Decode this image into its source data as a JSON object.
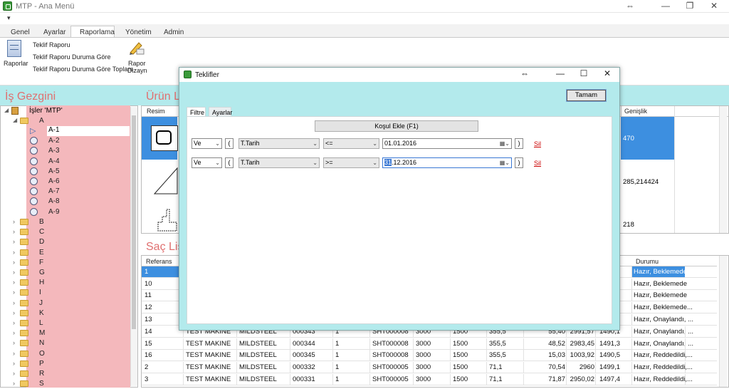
{
  "window": {
    "title": "MTP - Ana Menü",
    "restore_glyph": "⇔",
    "min_glyph": "—",
    "max_glyph": "❐",
    "close_glyph": "✕"
  },
  "qat_glyph": "▾",
  "ribbon": {
    "tabs": [
      "Genel",
      "Ayarlar",
      "Raporlama",
      "Yönetim",
      "Admin"
    ],
    "active_tab": "Raporlama",
    "raporlar_label": "Raporlar",
    "items": [
      "Teklif Raporu",
      "Teklif Raporu Duruma Göre",
      "Teklif Raporu Duruma Göre Toplam"
    ],
    "design_label_1": "Rapor",
    "design_label_2": "Dizayn"
  },
  "is_gezgini": {
    "title": "İş Gezgini",
    "root": "İşler 'MTP'",
    "open_folder": "A",
    "leaves": [
      "A-1",
      "A-2",
      "A-3",
      "A-4",
      "A-5",
      "A-6",
      "A-7",
      "A-8",
      "A-9"
    ],
    "folders": [
      "B",
      "C",
      "D",
      "E",
      "F",
      "G",
      "H",
      "I",
      "J",
      "K",
      "L",
      "M",
      "N",
      "O",
      "P",
      "R",
      "S"
    ]
  },
  "urun": {
    "title_partial": "Ürün Li",
    "headers": {
      "resim": "Resim",
      "genislik": "Genişlik"
    },
    "genislik_values": [
      "470",
      "285,214424",
      "218"
    ]
  },
  "sac": {
    "title_partial": "Saç Lis",
    "headers": {
      "referans": "Referans",
      "durumu": "Durumu"
    },
    "top_rows": [
      {
        "ref": "1",
        "durum": "Hazır, Beklemede"
      },
      {
        "ref": "10",
        "durum": "Hazır, Beklemede"
      },
      {
        "ref": "11",
        "durum": "Hazır, Beklemede"
      },
      {
        "ref": "12",
        "durum": "Hazır, Beklemede..."
      },
      {
        "ref": "13",
        "durum": "Hazır, Onaylandı, ..."
      }
    ],
    "rows": [
      {
        "ref": "14",
        "musteri": "TEST MAKINE",
        "malzeme": "MILDSTEEL",
        "kod": "000343",
        "adet": "1",
        "sht": "SHT000008",
        "en": "3000",
        "boy": "1500",
        "k": "355,5",
        "v1": "55,40",
        "v2": "2991,57",
        "v3": "1490,1",
        "durum": "Hazır, Onaylandı, ..."
      },
      {
        "ref": "15",
        "musteri": "TEST MAKINE",
        "malzeme": "MILDSTEEL",
        "kod": "000344",
        "adet": "1",
        "sht": "SHT000008",
        "en": "3000",
        "boy": "1500",
        "k": "355,5",
        "v1": "48,52",
        "v2": "2983,45",
        "v3": "1491,3",
        "durum": "Hazır, Onaylandı, ..."
      },
      {
        "ref": "16",
        "musteri": "TEST MAKINE",
        "malzeme": "MILDSTEEL",
        "kod": "000345",
        "adet": "1",
        "sht": "SHT000008",
        "en": "3000",
        "boy": "1500",
        "k": "355,5",
        "v1": "15,03",
        "v2": "1003,92",
        "v3": "1490,5",
        "durum": "Hazır, Reddedildi,..."
      },
      {
        "ref": "2",
        "musteri": "TEST MAKINE",
        "malzeme": "MILDSTEEL",
        "kod": "000332",
        "adet": "1",
        "sht": "SHT000005",
        "en": "3000",
        "boy": "1500",
        "k": "71,1",
        "v1": "70,54",
        "v2": "2960",
        "v3": "1499,1",
        "durum": "Hazır, Reddedildi,..."
      },
      {
        "ref": "3",
        "musteri": "TEST MAKINE",
        "malzeme": "MILDSTEEL",
        "kod": "000331",
        "adet": "1",
        "sht": "SHT000005",
        "en": "3000",
        "boy": "1500",
        "k": "71,1",
        "v1": "71,87",
        "v2": "2950,02",
        "v3": "1497,4",
        "durum": "Hazır, Reddedildi,..."
      }
    ]
  },
  "dialog": {
    "title": "Teklifler",
    "ok_button": "Tamam",
    "tabs": [
      "Filtre",
      "Ayarlar"
    ],
    "add_condition": "Koşul Ekle  (F1)",
    "filters": [
      {
        "logic": "Ve",
        "open": "(",
        "field": "T.Tarih",
        "op": "<=",
        "value": "01.01.2016",
        "close": ")",
        "delete": "Sil"
      },
      {
        "logic": "Ve",
        "open": "(",
        "field": "T.Tarih",
        "op": ">=",
        "value_sel": "31",
        "value_rest": ".12.2016",
        "close": ")",
        "delete": "Sil"
      }
    ]
  }
}
